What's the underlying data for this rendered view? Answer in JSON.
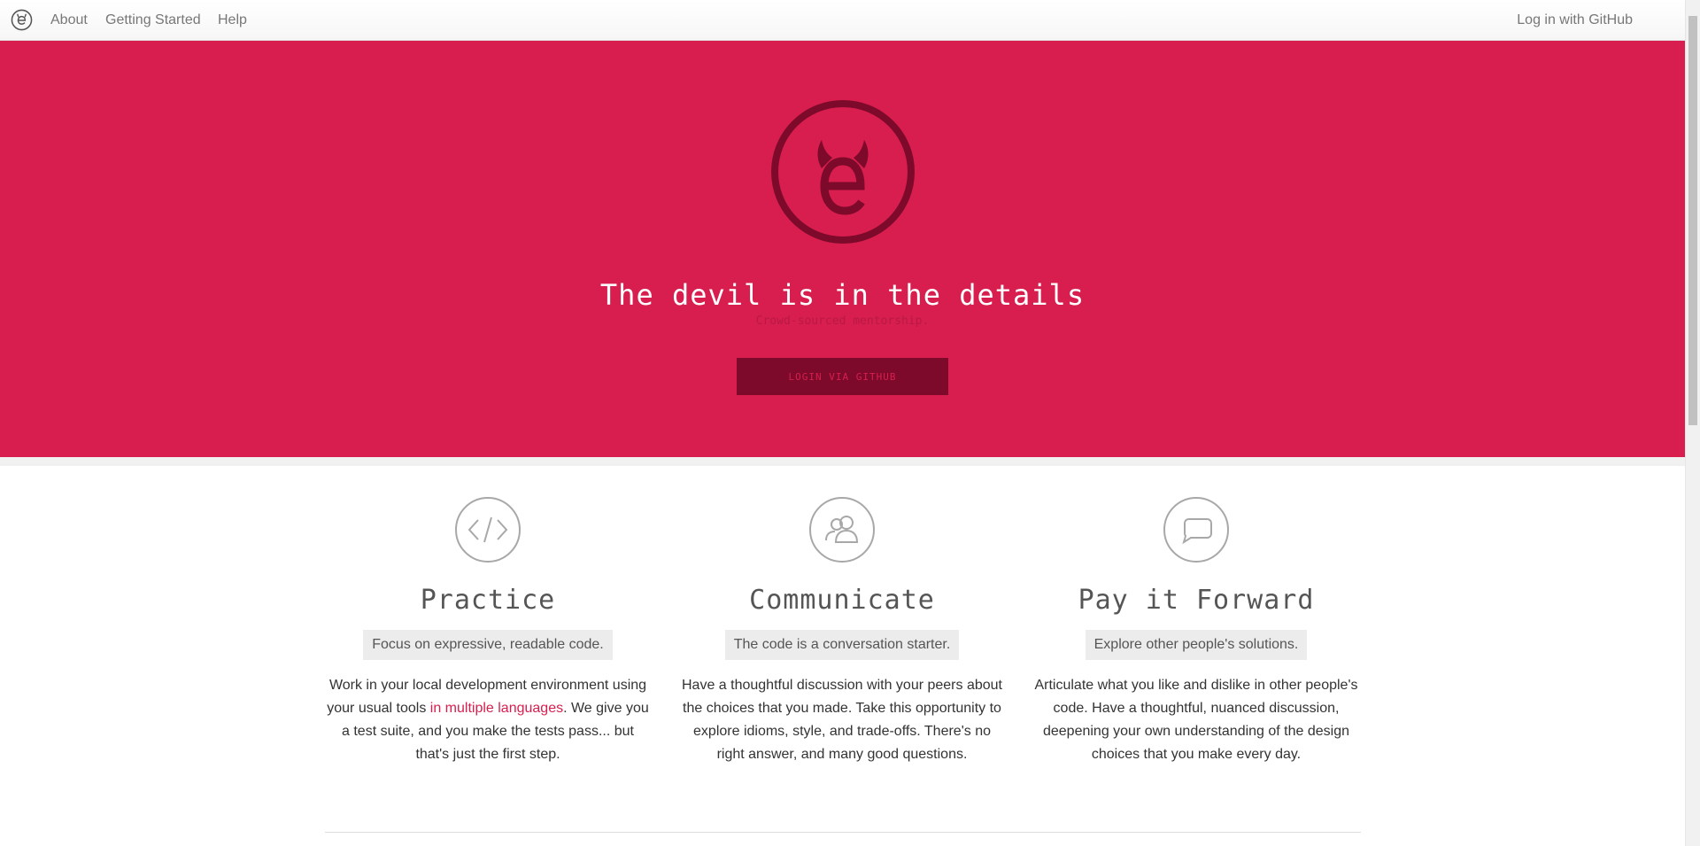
{
  "nav": {
    "logo_icon": "exercism-devil-e-icon",
    "about": "About",
    "getting_started": "Getting Started",
    "help": "Help",
    "login": "Log in with GitHub"
  },
  "hero": {
    "logo_icon": "exercism-devil-e-icon",
    "title": "The devil is in the details",
    "subtitle": "Crowd-sourced mentorship.",
    "button": "LOGIN VIA GITHUB"
  },
  "features": [
    {
      "icon": "code-icon",
      "title": "Practice",
      "tag": "Focus on expressive, readable code.",
      "body_before": "Work in your local development environment using your usual tools ",
      "link": "in multiple languages",
      "body_after": ". We give you a test suite, and you make the tests pass... but that's just the first step."
    },
    {
      "icon": "people-icon",
      "title": "Communicate",
      "tag": "The code is a conversation starter.",
      "body": "Have a thoughtful discussion with your peers about the choices that you made. Take this opportunity to explore idioms, style, and trade-offs. There's no right answer, and many good questions."
    },
    {
      "icon": "speech-bubble-icon",
      "title": "Pay it Forward",
      "tag": "Explore other people's solutions.",
      "body": "Articulate what you like and dislike in other people's code. Have a thoughtful, nuanced discussion, deepening your own understanding of the design choices that you make every day."
    }
  ],
  "colors": {
    "brand": "#d81e4e",
    "brand_dark": "#7d0a2b",
    "feature_icon": "#a8a8a8"
  }
}
